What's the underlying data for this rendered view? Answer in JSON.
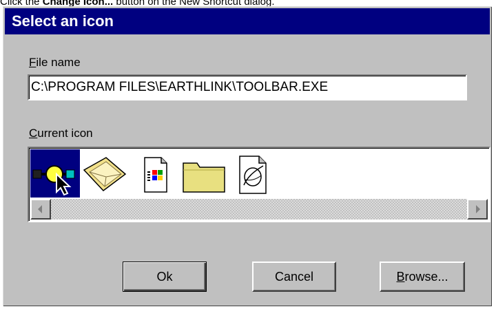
{
  "caption": {
    "prefix": "Click the ",
    "bold": "Change Icon...",
    "suffix": " button on the New Shortcut dialog."
  },
  "dialog": {
    "title": "Select an icon",
    "file_name": {
      "label_accel": "F",
      "label_rest": "ile name",
      "value": "C:\\PROGRAM FILES\\EARTHLINK\\TOOLBAR.EXE"
    },
    "current_icon": {
      "label_accel": "C",
      "label_rest": "urrent icon",
      "icons": [
        {
          "name": "earthlink-toolbar-icon",
          "selected": true
        },
        {
          "name": "mail-envelope-icon",
          "selected": false
        },
        {
          "name": "windows-document-icon",
          "selected": false
        },
        {
          "name": "folder-icon",
          "selected": false
        },
        {
          "name": "internet-document-icon",
          "selected": false
        }
      ]
    },
    "buttons": {
      "ok": "Ok",
      "cancel": "Cancel",
      "browse_accel": "B",
      "browse_rest": "rowse..."
    }
  },
  "colors": {
    "titlebar": "#000080",
    "face": "#c0c0c0",
    "selection": "#000080"
  }
}
